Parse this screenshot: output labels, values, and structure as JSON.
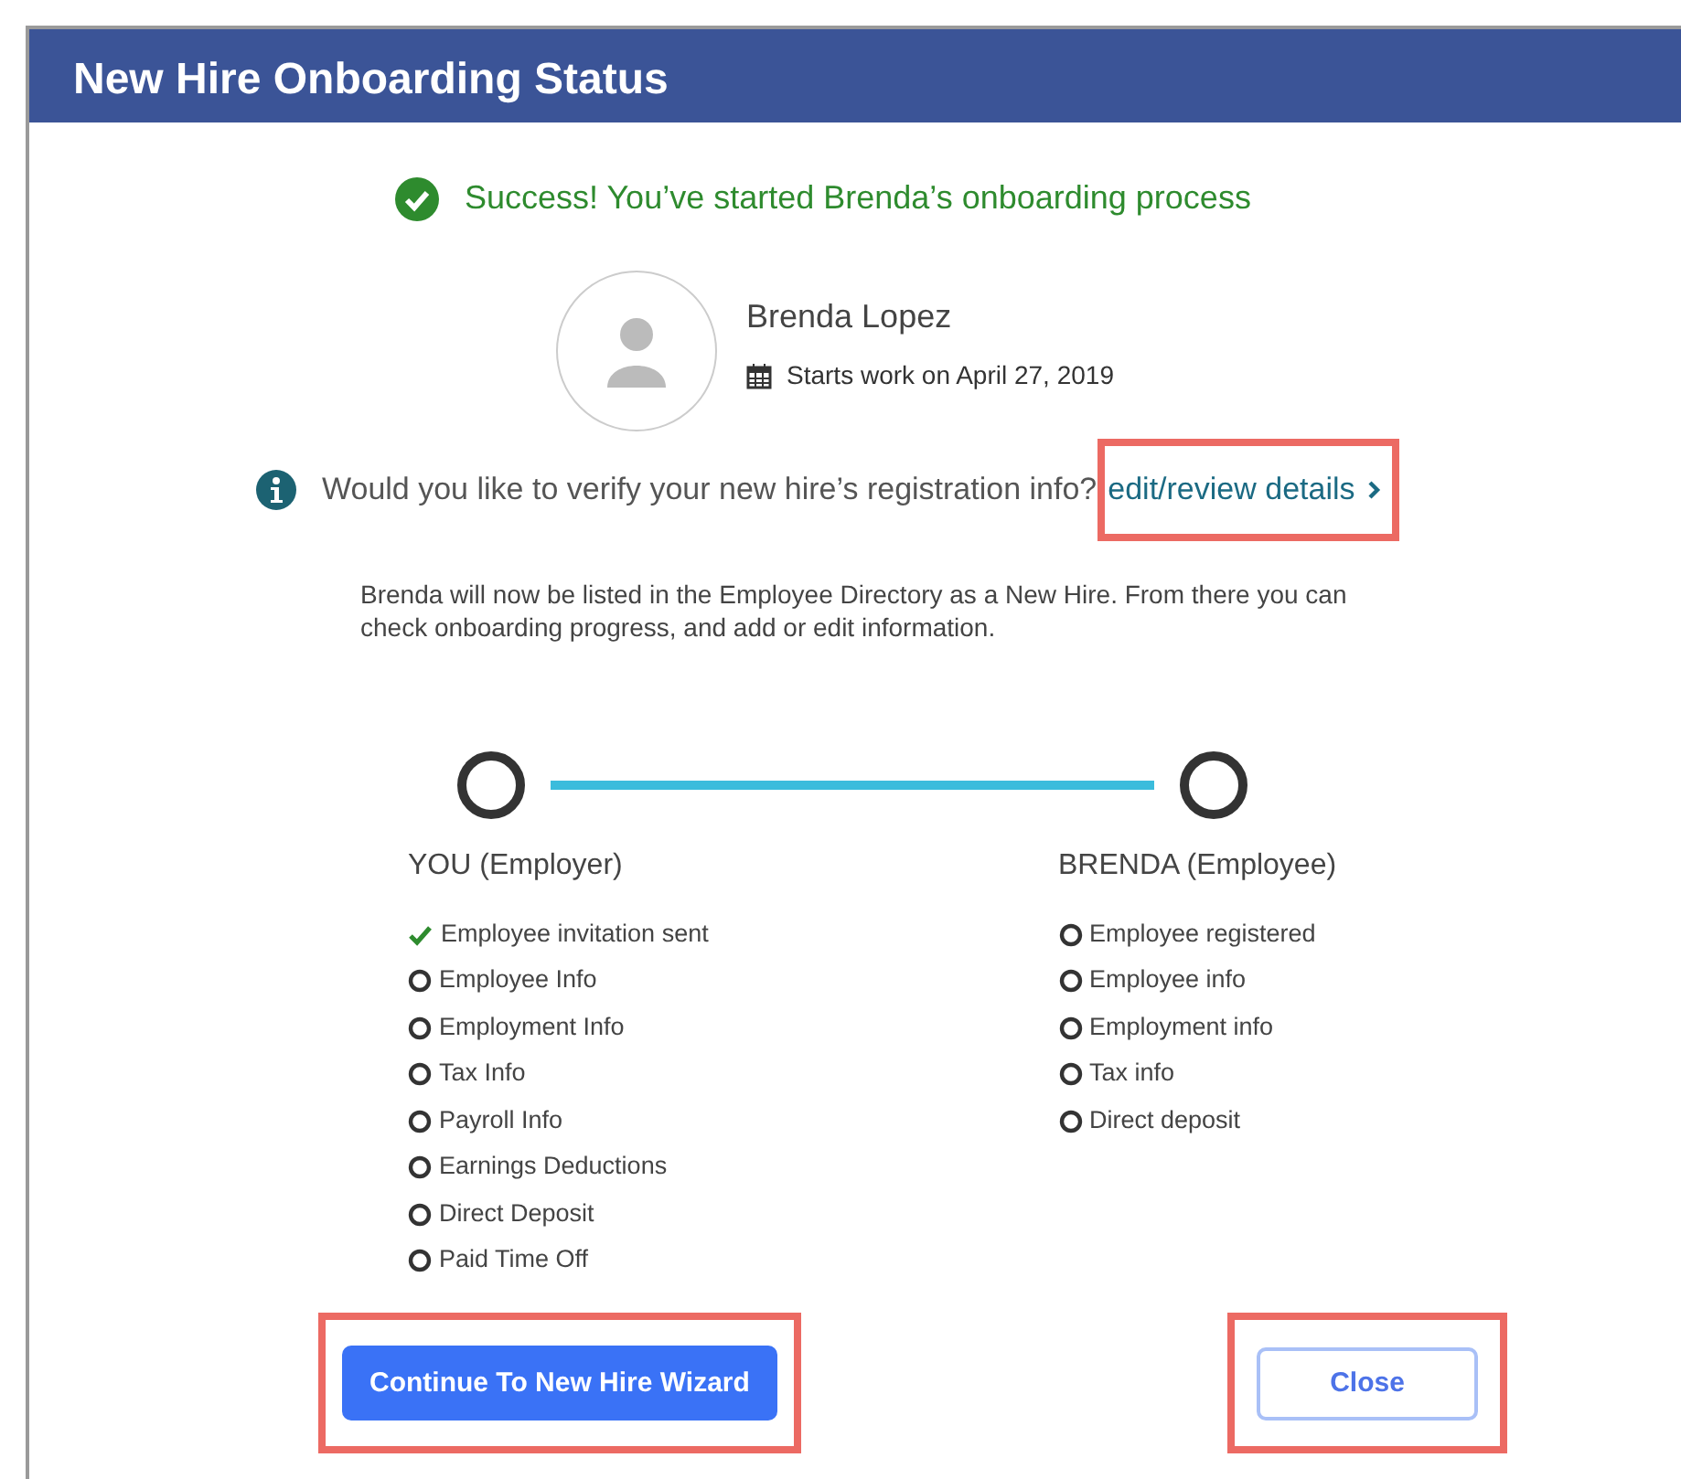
{
  "window": {
    "title": "New Hire Onboarding Status"
  },
  "success_message": "Success! You’ve started Brenda’s onboarding process",
  "profile": {
    "name": "Brenda Lopez",
    "start_date": "Starts work on April 27, 2019"
  },
  "verify": {
    "question": "Would you like to verify your new hire’s registration info?",
    "link": {
      "label": "edit/review details",
      "highlighted": true
    }
  },
  "note": "Brenda will now be listed in the Employee Directory as a New Hire. From there you can check onboarding progress, and add or edit information.",
  "columns": [
    {
      "heading": "YOU (Employer)",
      "steps": [
        {
          "label": "Employee invitation sent",
          "done": true
        },
        {
          "label": "Employee Info",
          "done": false
        },
        {
          "label": "Employment Info",
          "done": false
        },
        {
          "label": "Tax Info",
          "done": false
        },
        {
          "label": "Payroll Info",
          "done": false
        },
        {
          "label": "Earnings Deductions",
          "done": false
        },
        {
          "label": "Direct Deposit",
          "done": false
        },
        {
          "label": "Paid Time Off",
          "done": false
        }
      ]
    },
    {
      "heading": "BRENDA (Employee)",
      "steps": [
        {
          "label": "Employee registered",
          "done": false
        },
        {
          "label": "Employee info",
          "done": false
        },
        {
          "label": "Employment info",
          "done": false
        },
        {
          "label": "Tax info",
          "done": false
        },
        {
          "label": "Direct deposit",
          "done": false
        }
      ]
    }
  ],
  "buttons": [
    {
      "label": "Continue To New Hire Wizard",
      "kind": "primary",
      "highlighted": true
    },
    {
      "label": "Close",
      "kind": "outline",
      "highlighted": true
    }
  ]
}
